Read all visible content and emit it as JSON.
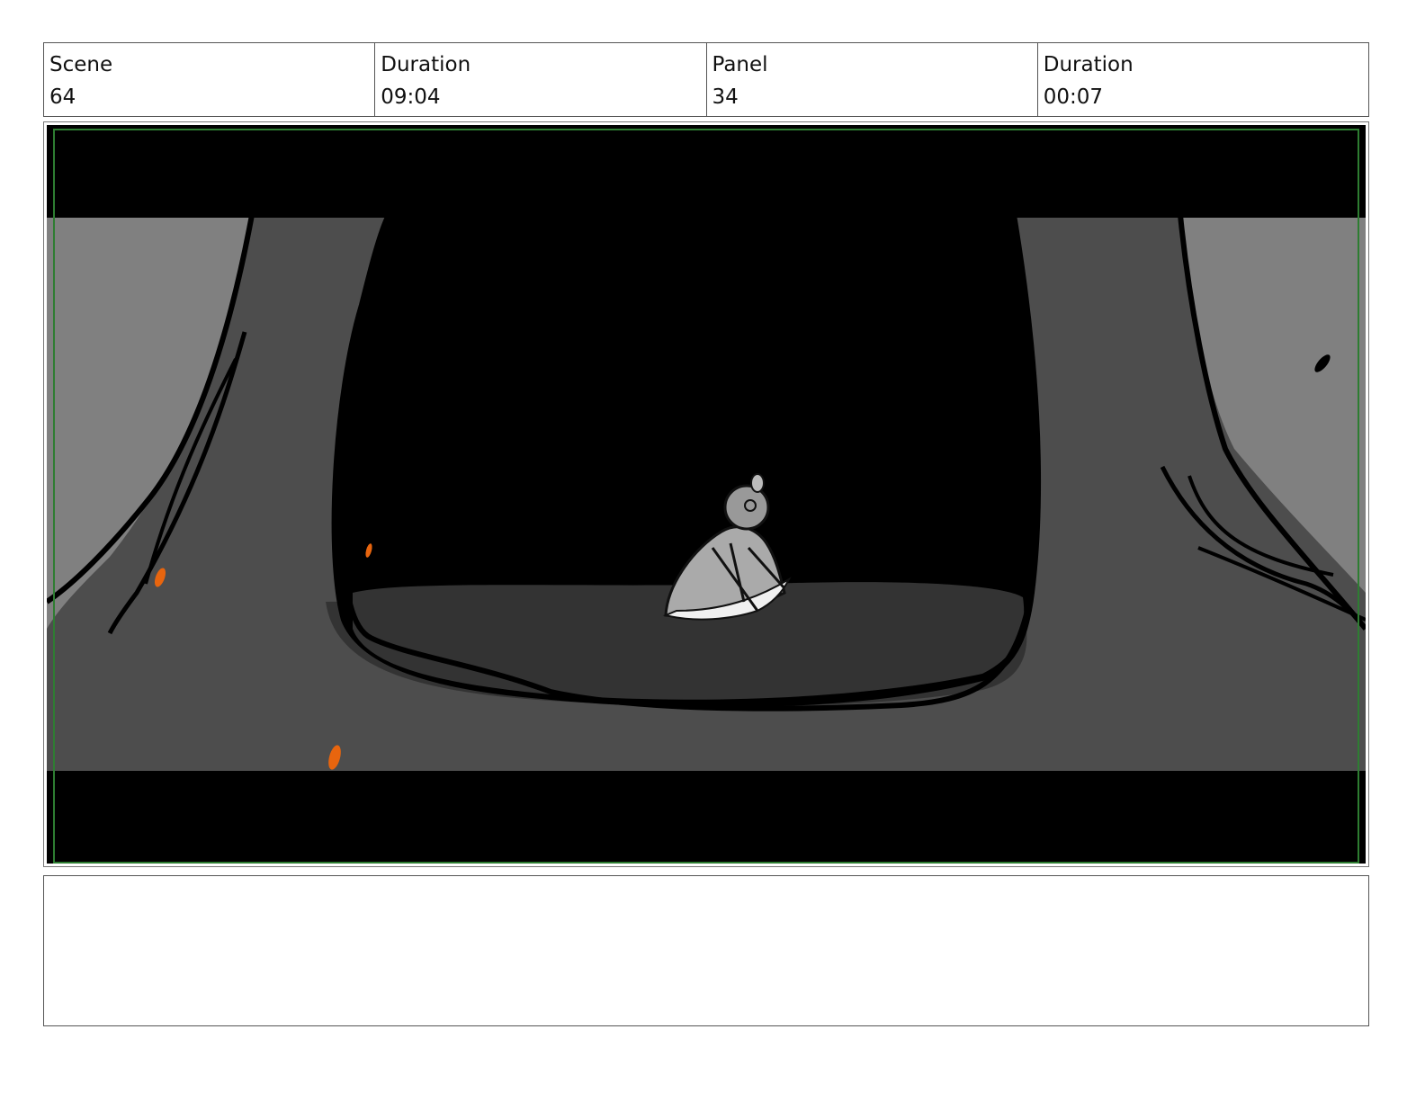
{
  "header": {
    "cells": [
      {
        "label": "Scene",
        "value": "64"
      },
      {
        "label": "Duration",
        "value": "09:04"
      },
      {
        "label": "Panel",
        "value": "34"
      },
      {
        "label": "Duration",
        "value": "00:07"
      }
    ]
  },
  "notes": {
    "text": ""
  },
  "colors": {
    "background": "#ffffff",
    "letterbox": "#000000",
    "ground": "#4d4d4d",
    "wall": "#808080",
    "shadow": "#333333",
    "safe_frame": "#2e7d32",
    "ember": "#e8650e"
  }
}
